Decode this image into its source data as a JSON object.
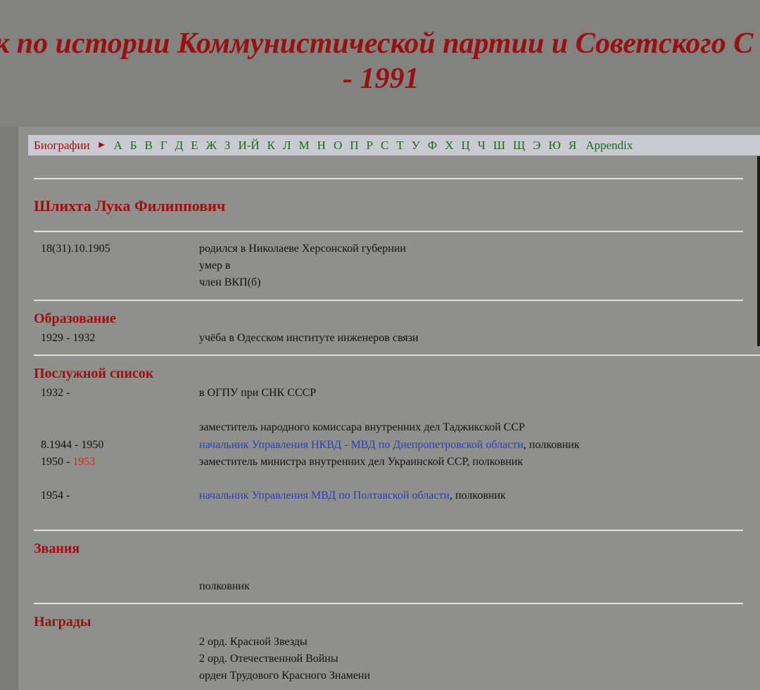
{
  "header": {
    "title_line1": "к по истории Коммунистической партии и Советского С",
    "title_line2": "- 1991"
  },
  "nav": {
    "biographies": "Биографии",
    "arrow": "►",
    "letters": [
      "А",
      "Б",
      "В",
      "Г",
      "Д",
      "Е",
      "Ж",
      "З",
      "И-Й",
      "К",
      "Л",
      "М",
      "Н",
      "О",
      "П",
      "Р",
      "С",
      "Т",
      "У",
      "Ф",
      "Х",
      "Ц",
      "Ч",
      "Ш",
      "Щ",
      "Э",
      "Ю",
      "Я"
    ],
    "appendix": "Appendix"
  },
  "person": {
    "name": "Шлихта Лука Филиппович",
    "birth_date": "18(31).10.1905",
    "born": "родился в Николаеве Херсонской губернии",
    "died": "умер в",
    "party": "член ВКП(б)"
  },
  "education": {
    "title": "Образование",
    "rows": [
      {
        "date": "1929 - 1932",
        "text": "учёба в Одесском институте инженеров связи"
      }
    ]
  },
  "service": {
    "title": "Послужной список",
    "rows": [
      {
        "date": "1932 -",
        "text": "в ОГПУ при СНК СССР"
      },
      {
        "date": "",
        "text": "заместитель народного комиссара внутренних дел Таджикской ССР"
      },
      {
        "date": "8.1944 - 1950",
        "link": "начальник Управления НКВД - МВД по Днепропетровской области",
        "suffix": ", полковник"
      },
      {
        "date_start": "1950 - ",
        "date_end": "1953",
        "text": "заместитель министра внутренних дел Украинской ССР, полковник"
      },
      {
        "date": "1954 -",
        "link": "начальник Управления МВД по Полтавской области",
        "suffix": ", полковник"
      }
    ]
  },
  "ranks": {
    "title": "Звания",
    "items": [
      "полковник"
    ]
  },
  "awards": {
    "title": "Награды",
    "items": [
      "2 орд. Красной Звезды",
      "2 орд. Отечественной Войны",
      "орден Трудового Красного Знамени"
    ]
  },
  "colors": {
    "accent_red": "#9b0f12",
    "nav_green": "#19691c",
    "link_blue": "#2b3fb8",
    "background": "#8f908b"
  }
}
